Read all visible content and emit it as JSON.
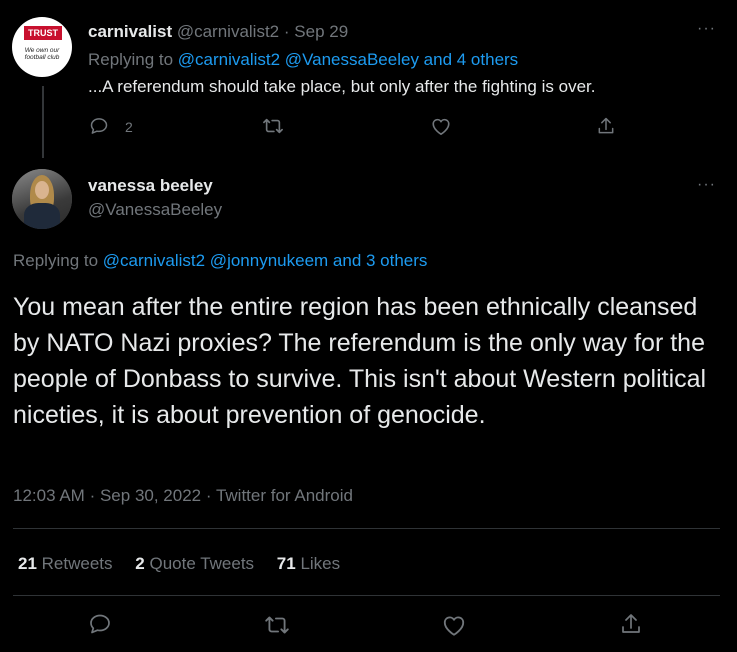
{
  "reply": {
    "display_name": "carnivalist",
    "handle": "@carnivalist2",
    "separator": "·",
    "date": "Sep 29",
    "avatar_text_top": "TRUST",
    "avatar_text_bottom": "We own our football club",
    "replying_prefix": "Replying to",
    "replying_handles": "@carnivalist2 @VanessaBeeley and 4 others",
    "text": "...A referendum should take place, but only after the fighting is over.",
    "reply_count": "2",
    "more_glyph": "···"
  },
  "main": {
    "display_name": "vanessa beeley",
    "handle": "@VanessaBeeley",
    "more_glyph": "···",
    "replying_prefix": "Replying to",
    "replying_handles": "@carnivalist2 @jonnynukeem and 3 others",
    "text": "You mean after the entire region has been ethnically cleansed by NATO Nazi proxies? The referendum is the only way for the people of Donbass to survive. This isn't about Western political niceties, it is about prevention of genocide.",
    "time": "12:03 AM",
    "separator": "·",
    "date": "Sep 30, 2022",
    "separator2": "·",
    "source": "Twitter for Android"
  },
  "stats": {
    "retweets_count": "21",
    "retweets_label": "Retweets",
    "quotes_count": "2",
    "quotes_label": "Quote Tweets",
    "likes_count": "71",
    "likes_label": "Likes"
  },
  "icons": {
    "reply": "reply-icon",
    "retweet": "retweet-icon",
    "like": "heart-icon",
    "share": "share-icon"
  },
  "colors": {
    "background": "#000000",
    "text": "#e7e9ea",
    "muted": "#71767b",
    "link": "#1d9bf0",
    "divider": "#2f3336",
    "avatar_brand_red": "#c8102e"
  }
}
